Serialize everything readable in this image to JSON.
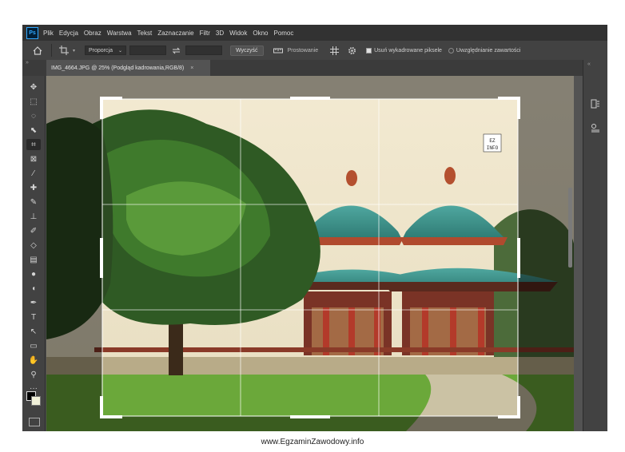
{
  "menu": {
    "logo": "Ps",
    "items": [
      "Plik",
      "Edycja",
      "Obraz",
      "Warstwa",
      "Tekst",
      "Zaznaczanie",
      "Filtr",
      "3D",
      "Widok",
      "Okno",
      "Pomoc"
    ]
  },
  "options": {
    "ratio_select": "Proporcja",
    "clear_label": "Wyczyść",
    "straighten_label": "Prostowanie",
    "delete_cropped_label": "Usuń wykadrowane piksele",
    "content_aware_label": "Uwzględnianie zawartości"
  },
  "document": {
    "tab_title": "IMG_4664.JPG @ 25% (Podgląd kadrowania,RGB/8)",
    "close_glyph": "×"
  },
  "icons": {
    "home": "home-icon",
    "crop_preset": "crop-icon",
    "swap": "swap-icon",
    "straighten": "ruler-icon",
    "grid_overlay": "grid-icon",
    "settings": "gear-icon"
  },
  "tools": [
    {
      "name": "move-tool-icon",
      "glyph": "✥"
    },
    {
      "name": "marquee-tool-icon",
      "glyph": "⬚"
    },
    {
      "name": "lasso-tool-icon",
      "glyph": "◌"
    },
    {
      "name": "quick-select-tool-icon",
      "glyph": "⬉"
    },
    {
      "name": "crop-tool-icon",
      "glyph": "⌗"
    },
    {
      "name": "frame-tool-icon",
      "glyph": "⊠"
    },
    {
      "name": "eyedropper-tool-icon",
      "glyph": "⁄"
    },
    {
      "name": "healing-tool-icon",
      "glyph": "✚"
    },
    {
      "name": "brush-tool-icon",
      "glyph": "✎"
    },
    {
      "name": "stamp-tool-icon",
      "glyph": "⊥"
    },
    {
      "name": "history-brush-tool-icon",
      "glyph": "✐"
    },
    {
      "name": "eraser-tool-icon",
      "glyph": "◇"
    },
    {
      "name": "gradient-tool-icon",
      "glyph": "▤"
    },
    {
      "name": "blur-tool-icon",
      "glyph": "●"
    },
    {
      "name": "dodge-tool-icon",
      "glyph": "◖"
    },
    {
      "name": "pen-tool-icon",
      "glyph": "✒"
    },
    {
      "name": "type-tool-icon",
      "glyph": "T"
    },
    {
      "name": "path-select-tool-icon",
      "glyph": "↖"
    },
    {
      "name": "rectangle-tool-icon",
      "glyph": "▭"
    },
    {
      "name": "hand-tool-icon",
      "glyph": "✋"
    },
    {
      "name": "zoom-tool-icon",
      "glyph": "⚲"
    },
    {
      "name": "more-tools-icon",
      "glyph": "···"
    }
  ],
  "watermark_logo": "EZ INFO",
  "footer": "www.EgzaminZawodowy.info"
}
